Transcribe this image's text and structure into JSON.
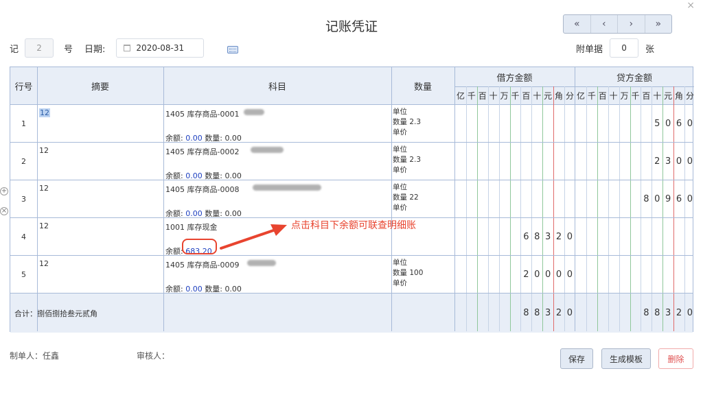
{
  "title": "记账凭证",
  "close_icon": "×",
  "nav": [
    "«",
    "‹",
    "›",
    "»"
  ],
  "voucher": {
    "label_ji": "记",
    "number": "2",
    "label_hao": "号",
    "date_label": "日期:",
    "date": "2020-08-31"
  },
  "attach": {
    "label": "附单据",
    "count": "0",
    "unit": "张"
  },
  "headers": {
    "rowno": "行号",
    "summary": "摘要",
    "subject": "科目",
    "quantity": "数量",
    "debit": "借方金额",
    "credit": "贷方金额"
  },
  "digits": [
    "亿",
    "千",
    "百",
    "十",
    "万",
    "千",
    "百",
    "十",
    "元",
    "角",
    "分"
  ],
  "rows": [
    {
      "no": "1",
      "summary": "12",
      "subject": "1405 库存商品-0001",
      "bal_label": "余额:",
      "bal": "0.00",
      "qty_label": "数量:",
      "qty_val": "0.00",
      "unit": "单位",
      "qty": "数量 2.3",
      "price": "单价",
      "debit": [
        "",
        "",
        "",
        "",
        "",
        "",
        "",
        "",
        "",
        "",
        ""
      ],
      "credit": [
        "",
        "",
        "",
        "",
        "",
        "",
        "",
        "5",
        "0",
        "6",
        "0"
      ]
    },
    {
      "no": "2",
      "summary": "12",
      "subject": "1405 库存商品-0002",
      "bal_label": "余额:",
      "bal": "0.00",
      "qty_label": "数量:",
      "qty_val": "0.00",
      "unit": "单位",
      "qty": "数量 2.3",
      "price": "单价",
      "debit": [
        "",
        "",
        "",
        "",
        "",
        "",
        "",
        "",
        "",
        "",
        ""
      ],
      "credit": [
        "",
        "",
        "",
        "",
        "",
        "",
        "",
        "2",
        "3",
        "0",
        "0"
      ]
    },
    {
      "no": "3",
      "summary": "12",
      "subject": "1405 库存商品-0008",
      "bal_label": "余额:",
      "bal": "0.00",
      "qty_label": "数量:",
      "qty_val": "0.00",
      "unit": "单位",
      "qty": "数量 22",
      "price": "单价",
      "debit": [
        "",
        "",
        "",
        "",
        "",
        "",
        "",
        "",
        "",
        "",
        ""
      ],
      "credit": [
        "",
        "",
        "",
        "",
        "",
        "",
        "8",
        "0",
        "9",
        "6",
        "0"
      ]
    },
    {
      "no": "4",
      "summary": "12",
      "subject": "1001 库存现金",
      "bal_label": "余额:",
      "bal": "683.20",
      "qty_label": "",
      "qty_val": "",
      "unit": "",
      "qty": "",
      "price": "",
      "debit": [
        "",
        "",
        "",
        "",
        "",
        "",
        "6",
        "8",
        "3",
        "2",
        "0"
      ],
      "credit": [
        "",
        "",
        "",
        "",
        "",
        "",
        "",
        "",
        "",
        "",
        ""
      ]
    },
    {
      "no": "5",
      "summary": "12",
      "subject": "1405 库存商品-0009",
      "bal_label": "余额:",
      "bal": "0.00",
      "qty_label": "数量:",
      "qty_val": "0.00",
      "unit": "单位",
      "qty": "数量 100",
      "price": "单价",
      "debit": [
        "",
        "",
        "",
        "",
        "",
        "",
        "2",
        "0",
        "0",
        "0",
        "0"
      ],
      "credit": [
        "",
        "",
        "",
        "",
        "",
        "",
        "",
        "",
        "",
        "",
        ""
      ]
    }
  ],
  "total": {
    "label": "合计：捌佰捌拾叁元贰角",
    "debit": [
      "",
      "",
      "",
      "",
      "",
      "",
      "8",
      "8",
      "3",
      "2",
      "0"
    ],
    "credit": [
      "",
      "",
      "",
      "",
      "",
      "",
      "8",
      "8",
      "3",
      "2",
      "0"
    ]
  },
  "annotation": "点击科目下余额可联查明细账",
  "footer": {
    "maker": "制单人：任鑫",
    "auditor": "审核人："
  },
  "buttons": {
    "save": "保存",
    "template": "生成模板",
    "delete": "删除"
  }
}
